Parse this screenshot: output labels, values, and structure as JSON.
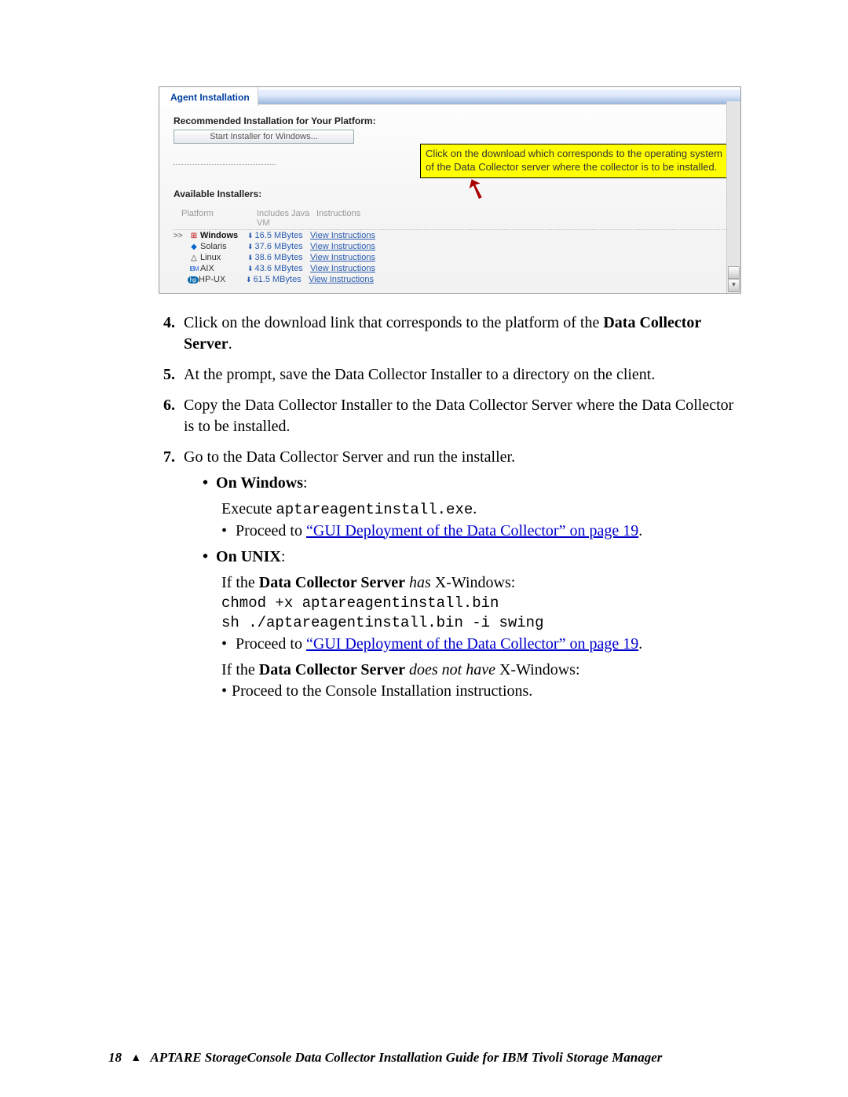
{
  "screenshot": {
    "tab_label": "Agent Installation",
    "rec_title": "Recommended Installation for Your Platform:",
    "start_button": "Start Installer for Windows...",
    "yellow_note": "Click on the download which corresponds to the operating system of the Data Collector server where the collector is to be installed.",
    "avail_label": "Available Installers:",
    "head_platform": "Platform",
    "head_vm": "Includes Java VM",
    "head_inst": "Instructions",
    "rows": {
      "r0": {
        "marker": ">>",
        "name": "Windows",
        "size": "16.5 MBytes",
        "link": "View Instructions"
      },
      "r1": {
        "marker": "",
        "name": "Solaris",
        "size": "37.6 MBytes",
        "link": "View Instructions"
      },
      "r2": {
        "marker": "",
        "name": "Linux",
        "size": "38.6 MBytes",
        "link": "View Instructions"
      },
      "r3": {
        "marker": "",
        "name": "AIX",
        "size": "43.6 MBytes",
        "link": "View Instructions"
      },
      "r4": {
        "marker": "",
        "name": "HP-UX",
        "size": "61.5 MBytes",
        "link": "View Instructions"
      }
    }
  },
  "steps": {
    "s4_a": "Click on the download link that corresponds to the platform of the ",
    "s4_b": "Data Collector Server",
    "s4_c": ".",
    "s5": "At the prompt, save the Data Collector Installer to a directory on the client.",
    "s6": "Copy the Data Collector Installer to the Data Collector Server where the Data Collector is to be installed.",
    "s7": "Go to the Data Collector Server and run the installer.",
    "win_label": "On Windows",
    "win_colon": ":",
    "win_exec_a": "Execute ",
    "win_exec_b": "aptareagentinstall.exe",
    "win_exec_c": ".",
    "proceed_a": "Proceed to ",
    "gui_link": "“GUI Deployment of the Data Collector” on page 19",
    "period": ".",
    "unix_label": "On UNIX",
    "unix_colon": ":",
    "unix_has_a": "If the ",
    "unix_has_b": "Data Collector Server",
    "unix_has_c": " has",
    "unix_has_d": " X-Windows:",
    "unix_cmd1": "chmod +x aptareagentinstall.bin",
    "unix_cmd2": "sh ./aptareagentinstall.bin -i swing",
    "unix_nohas_a": "If the ",
    "unix_nohas_b": "Data Collector Server",
    "unix_nohas_c": " does not have",
    "unix_nohas_d": " X-Windows:",
    "console_line": "Proceed to the Console Installation instructions."
  },
  "footer": {
    "page": "18",
    "title": "APTARE StorageConsole Data Collector Installation Guide for IBM Tivoli Storage Manager"
  }
}
